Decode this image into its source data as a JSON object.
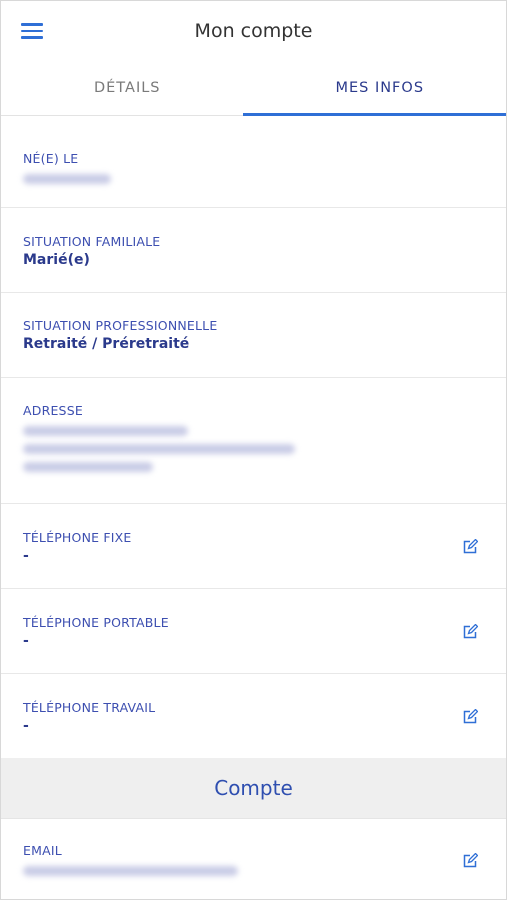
{
  "header": {
    "title": "Mon compte"
  },
  "tabs": [
    {
      "label": "DÉTAILS"
    },
    {
      "label": "MES INFOS"
    }
  ],
  "rows": {
    "birth": {
      "label": "NÉ(E) LE"
    },
    "family": {
      "label": "SITUATION FAMILIALE",
      "value": "Marié(e)"
    },
    "professional": {
      "label": "SITUATION PROFESSIONNELLE",
      "value": "Retraité / Préretraité"
    },
    "address": {
      "label": "ADRESSE"
    },
    "phone_fixed": {
      "label": "TÉLÉPHONE FIXE",
      "value": "-"
    },
    "phone_mobile": {
      "label": "TÉLÉPHONE PORTABLE",
      "value": "-"
    },
    "phone_work": {
      "label": "TÉLÉPHONE TRAVAIL",
      "value": "-"
    },
    "email": {
      "label": "EMAIL"
    }
  },
  "section": {
    "title": "Compte"
  },
  "icons": {
    "menu": "hamburger-menu-icon",
    "edit": "edit-pencil-icon"
  },
  "colors": {
    "accent": "#2f6fd6",
    "text": "#2b3a8c"
  }
}
